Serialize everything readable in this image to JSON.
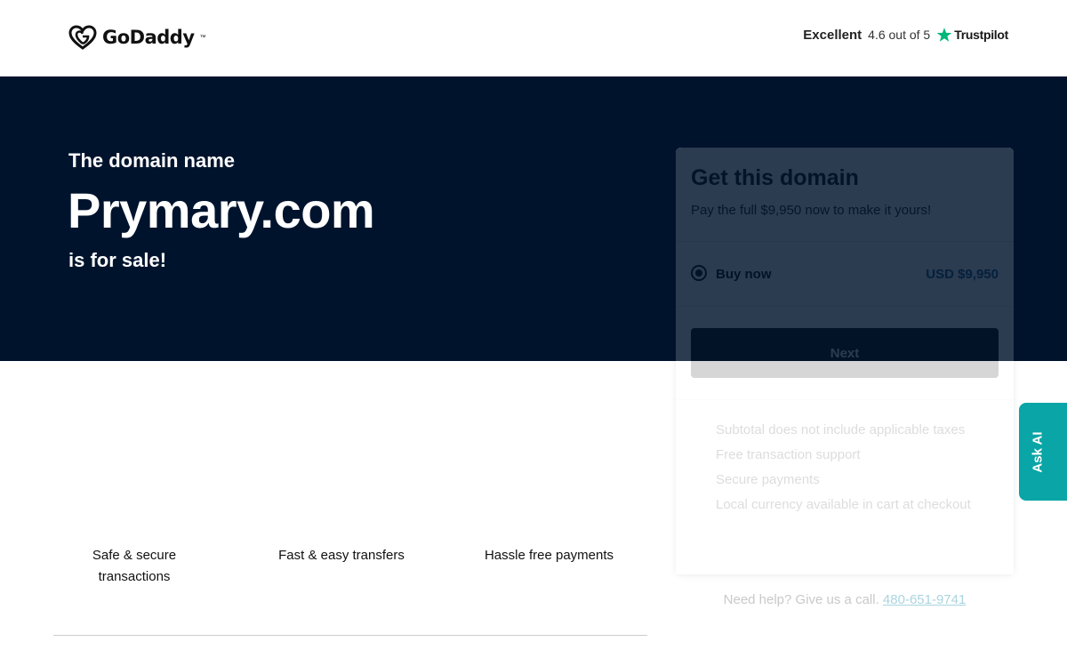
{
  "header": {
    "logo_text": "GoDaddy",
    "logo_tm": "™",
    "trust_rating_word": "Excellent",
    "trust_score": "4.6 out of 5",
    "trust_brand": "Trustpilot",
    "trust_star_color": "#00b67a"
  },
  "hero": {
    "pre_title": "The domain name",
    "domain": "Prymary.com",
    "post_title": "is for sale!",
    "background_color": "#00132d"
  },
  "card": {
    "title": "Get this domain",
    "subtitle": "Pay the full $9,950 now to make it yours!",
    "option_label": "Buy now",
    "option_price": "USD $9,950",
    "option_selected": true,
    "next_label": "Next",
    "features": [
      "Subtotal does not include applicable taxes",
      "Free transaction support",
      "Secure payments",
      "Local currency available in cart at checkout"
    ]
  },
  "help": {
    "text": "Need help? Give us a call.",
    "phone": "480-651-9741"
  },
  "benefits": {
    "items": [
      {
        "line1": "Safe & secure",
        "line2": "transactions"
      },
      {
        "line1": "Fast & easy transfers",
        "line2": ""
      },
      {
        "line1": "Hassle free payments",
        "line2": ""
      }
    ]
  },
  "ask_ai": {
    "label": "Ask AI",
    "color": "#0aa5a6"
  }
}
